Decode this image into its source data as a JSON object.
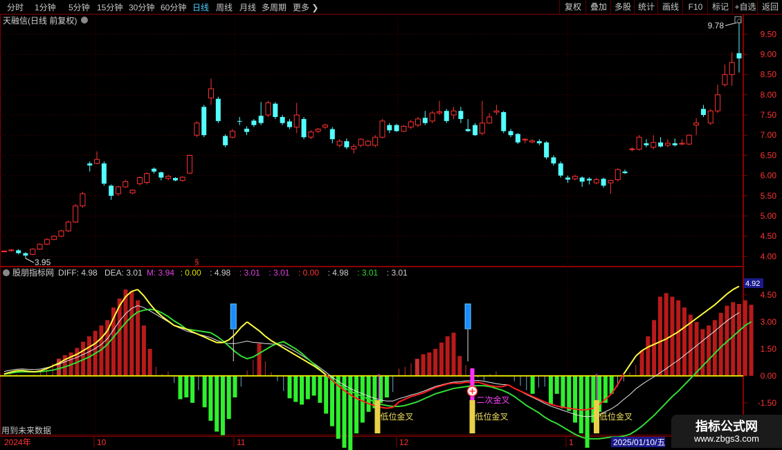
{
  "toolbar": {
    "periods": [
      {
        "label": "分时",
        "x": 10
      },
      {
        "label": "1分钟",
        "x": 50
      },
      {
        "label": "5分钟",
        "x": 99
      },
      {
        "label": "15分钟",
        "x": 140
      },
      {
        "label": "30分钟",
        "x": 186
      },
      {
        "label": "60分钟",
        "x": 232
      },
      {
        "label": "日线",
        "x": 278,
        "active": true
      },
      {
        "label": "周线",
        "x": 312
      },
      {
        "label": "月线",
        "x": 346
      },
      {
        "label": "多周期",
        "x": 378
      },
      {
        "label": "更多 ❯",
        "x": 423
      }
    ],
    "right_buttons": [
      "复权",
      "叠加",
      "多股",
      "统计",
      "画线",
      "F10",
      "标记",
      "+自选",
      "返回"
    ]
  },
  "main_chart": {
    "title": "天融信(日线 前复权)",
    "high_label": "9.78",
    "low_label": "3.95",
    "price_axis": [
      "9.50",
      "9.00",
      "8.50",
      "8.00",
      "7.50",
      "7.00",
      "6.50",
      "6.00",
      "5.50",
      "5.00",
      "4.50",
      "4.00"
    ],
    "marker_glyph": "§"
  },
  "indicator": {
    "name": "股朋指标网",
    "readout": [
      {
        "text": "DIFF: 4.98",
        "color": "#d0d0d0"
      },
      {
        "text": "DEA: 3.01",
        "color": "#d0d0d0"
      },
      {
        "text": "M: 3.94",
        "color": "#e040e0"
      },
      {
        "text": ": 0.00",
        "color": "#e0e000"
      },
      {
        "text": ": 4.98",
        "color": "#d0d0d0"
      },
      {
        "text": ": 3.01",
        "color": "#e040e0"
      },
      {
        "text": ": 3.01",
        "color": "#e040e0"
      },
      {
        "text": ": 0.00",
        "color": "#ff3333"
      },
      {
        "text": ": 4.98",
        "color": "#d0d0d0"
      },
      {
        "text": ": 3.01",
        "color": "#33dd33"
      },
      {
        "text": ": 3.01",
        "color": "#d0d0d0"
      }
    ],
    "current_value": "4.92",
    "axis": [
      "4.50",
      "3.00",
      "1.50",
      "0.00",
      "-1.50"
    ],
    "annotations": {
      "low_cross": "低位金叉",
      "second_cross": "二次金叉"
    },
    "footer_note": "用到未来数据"
  },
  "timeline": {
    "year": "2024年",
    "months": [
      {
        "label": "10",
        "x": 140
      },
      {
        "label": "11",
        "x": 342
      },
      {
        "label": "12",
        "x": 577
      },
      {
        "label": "1",
        "x": 822
      }
    ],
    "cursor_date": "2025/01/10/五"
  },
  "watermark": {
    "title": "指标公式网",
    "url": "www.zbgs3.com"
  },
  "colors": {
    "up": "#ff3232",
    "down": "#54ffff",
    "frame": "#8b0000",
    "diff": "#ffff40",
    "dea": "#33dd33",
    "bg": "#000000"
  },
  "chart_data": {
    "type": "candlestick",
    "title": "天融信(日线 前复权)",
    "candles": [
      [
        4.12,
        4.13,
        4.1,
        4.15
      ],
      [
        4.14,
        4.16,
        4.12,
        4.18
      ],
      [
        4.15,
        4.08,
        4.05,
        4.18
      ],
      [
        4.08,
        4.02,
        3.95,
        4.1
      ],
      [
        4.05,
        4.18,
        4.03,
        4.2
      ],
      [
        4.18,
        4.3,
        4.16,
        4.32
      ],
      [
        4.3,
        4.42,
        4.28,
        4.45
      ],
      [
        4.42,
        4.5,
        4.4,
        4.52
      ],
      [
        4.5,
        4.63,
        4.48,
        4.65
      ],
      [
        4.63,
        4.85,
        4.6,
        4.88
      ],
      [
        4.85,
        5.25,
        4.83,
        5.3
      ],
      [
        5.25,
        5.55,
        5.2,
        5.6
      ],
      [
        6.3,
        6.25,
        6.1,
        6.35
      ],
      [
        6.3,
        6.4,
        6.28,
        6.6
      ],
      [
        6.3,
        5.8,
        5.75,
        6.35
      ],
      [
        5.75,
        5.5,
        5.4,
        5.78
      ],
      [
        5.55,
        5.72,
        5.5,
        5.75
      ],
      [
        5.72,
        5.85,
        5.7,
        5.9
      ],
      [
        5.57,
        5.64,
        5.54,
        5.66
      ],
      [
        5.8,
        5.95,
        5.76,
        5.98
      ],
      [
        5.83,
        6.05,
        5.78,
        6.08
      ],
      [
        6.17,
        6.1,
        6.05,
        6.2
      ],
      [
        6.08,
        5.95,
        5.88,
        6.1
      ],
      [
        5.93,
        5.98,
        5.88,
        6.02
      ],
      [
        5.94,
        5.88,
        5.86,
        5.96
      ],
      [
        5.88,
        5.96,
        5.85,
        5.98
      ],
      [
        6.06,
        6.5,
        6.04,
        6.52
      ],
      [
        7.0,
        7.3,
        6.95,
        7.35
      ],
      [
        7.7,
        7.0,
        6.95,
        7.75
      ],
      [
        7.92,
        8.15,
        7.75,
        8.4
      ],
      [
        7.9,
        7.35,
        7.3,
        7.95
      ],
      [
        6.98,
        6.75,
        6.7,
        7.02
      ],
      [
        6.95,
        7.1,
        6.92,
        7.15
      ],
      [
        7.35,
        7.34,
        7.25,
        7.45
      ],
      [
        7.16,
        7.08,
        7.0,
        7.22
      ],
      [
        7.36,
        7.25,
        7.2,
        7.4
      ],
      [
        7.48,
        7.3,
        7.25,
        7.82
      ],
      [
        7.5,
        7.8,
        7.45,
        7.85
      ],
      [
        7.78,
        7.45,
        7.4,
        7.82
      ],
      [
        7.45,
        7.3,
        7.25,
        7.5
      ],
      [
        7.34,
        7.2,
        7.15,
        7.4
      ],
      [
        7.2,
        7.5,
        7.05,
        7.8
      ],
      [
        7.4,
        6.95,
        6.9,
        7.45
      ],
      [
        6.95,
        7.08,
        6.9,
        7.12
      ],
      [
        7.1,
        7.15,
        7.05,
        7.18
      ],
      [
        7.2,
        7.25,
        7.15,
        7.28
      ],
      [
        7.15,
        6.9,
        6.8,
        7.2
      ],
      [
        6.75,
        6.85,
        6.7,
        6.9
      ],
      [
        6.85,
        6.7,
        6.65,
        6.92
      ],
      [
        6.66,
        6.72,
        6.55,
        6.78
      ],
      [
        6.75,
        6.9,
        6.7,
        6.92
      ],
      [
        6.75,
        6.85,
        6.72,
        6.88
      ],
      [
        6.75,
        6.95,
        6.7,
        7.0
      ],
      [
        6.95,
        7.35,
        6.92,
        7.4
      ],
      [
        7.25,
        7.12,
        7.05,
        7.3
      ],
      [
        7.25,
        7.1,
        7.08,
        7.28
      ],
      [
        7.1,
        7.22,
        7.08,
        7.25
      ],
      [
        7.2,
        7.33,
        7.15,
        7.38
      ],
      [
        7.25,
        7.4,
        7.2,
        7.45
      ],
      [
        7.43,
        7.3,
        7.25,
        7.6
      ],
      [
        7.35,
        7.55,
        7.3,
        7.6
      ],
      [
        7.55,
        7.58,
        7.5,
        7.85
      ],
      [
        7.6,
        7.35,
        7.3,
        7.65
      ],
      [
        7.5,
        7.6,
        7.4,
        7.7
      ],
      [
        7.6,
        7.4,
        7.3,
        7.7
      ],
      [
        7.15,
        7.1,
        7.08,
        7.4
      ],
      [
        7.25,
        7.0,
        6.98,
        7.3
      ],
      [
        7.05,
        7.3,
        7.0,
        7.85
      ],
      [
        7.3,
        7.45,
        7.28,
        7.55
      ],
      [
        7.57,
        7.6,
        7.5,
        7.75
      ],
      [
        7.57,
        7.1,
        7.05,
        7.6
      ],
      [
        7.1,
        7.0,
        6.95,
        7.15
      ],
      [
        7.03,
        6.82,
        6.78,
        7.05
      ],
      [
        6.88,
        6.9,
        6.8,
        6.92
      ],
      [
        6.83,
        6.86,
        6.8,
        6.9
      ],
      [
        6.85,
        6.8,
        6.75,
        6.9
      ],
      [
        6.82,
        6.45,
        6.4,
        6.85
      ],
      [
        6.45,
        6.3,
        6.25,
        6.5
      ],
      [
        6.3,
        6.0,
        5.95,
        6.35
      ],
      [
        5.95,
        5.9,
        5.82,
        6.0
      ],
      [
        5.92,
        5.98,
        5.88,
        6.02
      ],
      [
        5.95,
        5.85,
        5.72,
        5.98
      ],
      [
        5.92,
        5.88,
        5.78,
        5.96
      ],
      [
        5.82,
        5.9,
        5.78,
        5.95
      ],
      [
        5.92,
        5.75,
        5.7,
        5.95
      ],
      [
        5.82,
        5.88,
        5.55,
        5.9
      ],
      [
        5.9,
        6.15,
        5.85,
        6.18
      ],
      [
        6.1,
        6.06,
        6.04,
        6.15
      ],
      [
        6.65,
        6.66,
        6.6,
        6.7
      ],
      [
        6.65,
        6.95,
        6.62,
        7.0
      ],
      [
        6.8,
        6.75,
        6.7,
        6.9
      ],
      [
        6.7,
        6.82,
        6.65,
        7.0
      ],
      [
        6.82,
        6.72,
        6.7,
        6.95
      ],
      [
        6.75,
        6.8,
        6.7,
        6.9
      ],
      [
        6.8,
        6.75,
        6.72,
        6.92
      ],
      [
        6.78,
        6.8,
        6.75,
        6.9
      ],
      [
        6.78,
        7.0,
        6.75,
        7.02
      ],
      [
        7.25,
        7.3,
        7.0,
        7.42
      ],
      [
        7.65,
        7.5,
        7.45,
        7.75
      ],
      [
        7.3,
        7.6,
        7.25,
        7.65
      ],
      [
        7.6,
        8.0,
        7.55,
        8.25
      ],
      [
        8.25,
        8.5,
        8.2,
        8.75
      ],
      [
        8.5,
        8.8,
        8.22,
        9.05
      ],
      [
        9.03,
        8.9,
        8.55,
        9.78
      ]
    ],
    "marker_index": 27,
    "ylim": [
      3.95,
      9.78
    ],
    "indicator": {
      "diff": [
        0.1,
        0.2,
        0.28,
        0.3,
        0.25,
        0.22,
        0.28,
        0.4,
        0.55,
        0.7,
        0.9,
        1.05,
        1.2,
        1.4,
        1.6,
        1.8,
        2.1,
        2.5,
        3.2,
        3.9,
        4.4,
        4.7,
        4.8,
        4.45,
        4.0,
        3.6,
        3.3,
        3.05,
        2.8,
        2.7,
        2.6,
        2.45,
        2.3,
        2.15,
        2.0,
        1.85,
        1.85,
        2.0,
        2.3,
        2.7,
        3.0,
        2.75,
        2.5,
        2.2,
        1.95,
        1.75,
        1.55,
        1.35,
        1.15,
        0.95,
        0.75,
        0.55,
        0.32,
        0.05,
        -0.25,
        -0.55,
        -0.82,
        -1.05,
        -1.25,
        -1.4,
        -1.55,
        -1.65,
        -1.75,
        -1.8,
        -1.75,
        -1.45,
        -1.3,
        -1.15,
        -1.05,
        -0.95,
        -0.8,
        -0.65,
        -0.55,
        -0.45,
        -0.4,
        -0.42,
        -0.35,
        -0.38,
        -0.35,
        -0.45,
        -0.55,
        -0.6,
        -0.6,
        -0.5,
        -0.7,
        -0.85,
        -1.0,
        -1.15,
        -1.3,
        -1.45,
        -1.58,
        -1.68,
        -1.75,
        -1.8,
        -1.85,
        -1.9,
        -1.88,
        -1.8,
        -1.6,
        -1.3,
        -1.0,
        -0.5,
        0.1,
        0.6,
        1.1,
        1.4,
        1.6,
        1.75,
        1.9,
        2.05,
        2.25,
        2.45,
        2.7,
        2.95,
        3.2,
        3.45,
        3.7,
        3.95,
        4.25,
        4.55,
        4.8,
        4.98
      ],
      "dea": [
        0.1,
        0.15,
        0.2,
        0.22,
        0.22,
        0.22,
        0.23,
        0.27,
        0.32,
        0.4,
        0.5,
        0.62,
        0.75,
        0.9,
        1.05,
        1.25,
        1.45,
        1.75,
        2.15,
        2.55,
        2.95,
        3.3,
        3.55,
        3.65,
        3.7,
        3.65,
        3.5,
        3.3,
        3.05,
        2.85,
        2.6,
        2.55,
        2.5,
        2.45,
        2.4,
        2.2,
        1.95,
        1.65,
        1.35,
        1.1,
        0.95,
        1.05,
        1.25,
        1.45,
        1.65,
        1.8,
        1.9,
        1.7,
        1.5,
        1.25,
        0.95,
        0.65,
        0.35,
        0.05,
        -0.25,
        -0.45,
        -0.65,
        -0.85,
        -1.0,
        -1.15,
        -1.3,
        -1.45,
        -1.58,
        -1.65,
        -1.7,
        -1.7,
        -1.65,
        -1.55,
        -1.45,
        -1.3,
        -1.15,
        -1.0,
        -0.9,
        -0.8,
        -0.7,
        -0.65,
        -0.6,
        -0.55,
        -0.55,
        -0.55,
        -0.6,
        -0.7,
        -0.8,
        -0.95,
        -1.15,
        -1.4,
        -1.65,
        -1.85,
        -2.05,
        -2.3,
        -2.5,
        -2.65,
        -2.85,
        -3.05,
        -3.25,
        -3.4,
        -3.5,
        -3.5,
        -3.5,
        -3.45,
        -3.4,
        -3.4,
        -3.35,
        -3.25,
        -3.05,
        -2.8,
        -2.5,
        -2.2,
        -1.85,
        -1.5,
        -1.15,
        -0.85,
        -0.5,
        -0.15,
        0.2,
        0.55,
        0.9,
        1.25,
        1.6,
        1.9,
        2.2,
        2.5,
        2.8,
        3.01
      ],
      "histogram": [
        0.15,
        0.12,
        0.08,
        0.05,
        0.03,
        0.05,
        0.2,
        0.45,
        0.7,
        0.95,
        1.15,
        1.3,
        1.55,
        1.9,
        2.2,
        2.5,
        2.8,
        3.1,
        3.8,
        4.3,
        4.8,
        4.7,
        4.2,
        2.8,
        1.5,
        0.5,
        0.1,
        0.25,
        -0.4,
        -1.3,
        -1.2,
        -1.5,
        -0.8,
        -1.75,
        -2.5,
        -3.1,
        -3.3,
        -2.4,
        -1.2,
        -0.6,
        0.3,
        0.9,
        1.8,
        0.8,
        0.2,
        -0.3,
        -0.85,
        -1.25,
        -1.45,
        -1.6,
        -1.3,
        -1.1,
        -1.5,
        -2.1,
        -2.8,
        -3.5,
        -4.0,
        -4.2,
        -3.2,
        -2.6,
        -2.0,
        -1.8,
        -1.5,
        -1.2,
        -0.9,
        0.4,
        0.5,
        0.7,
        0.95,
        1.2,
        1.3,
        1.5,
        1.85,
        2.2,
        2.4,
        1.1,
        0.6,
        0.3,
        -0.1,
        -0.25,
        0.1,
        0.25,
        0.05,
        -0.05,
        -0.3,
        -0.55,
        -0.8,
        -1.0,
        -0.65,
        -0.6,
        -1.6,
        -1.0,
        -1.8,
        -1.95,
        -2.6,
        -3.2,
        -4.0,
        -2.6,
        -2.0,
        -1.5,
        -1.0,
        -0.6,
        -0.3,
        0.2,
        0.6,
        1.4,
        2.2,
        3.1,
        4.4,
        4.6,
        4.4,
        4.2,
        3.8,
        3.4,
        3.0,
        2.6,
        2.8,
        3.1,
        3.5,
        3.9,
        4.1,
        4.0,
        4.2,
        3.95
      ],
      "low_cross_positions": [
        0.508,
        0.637,
        0.806
      ],
      "second_cross_position": 0.637,
      "blue_markers": [
        0.311,
        0.63
      ],
      "pink_markers": [
        0.51,
        0.806
      ]
    }
  }
}
